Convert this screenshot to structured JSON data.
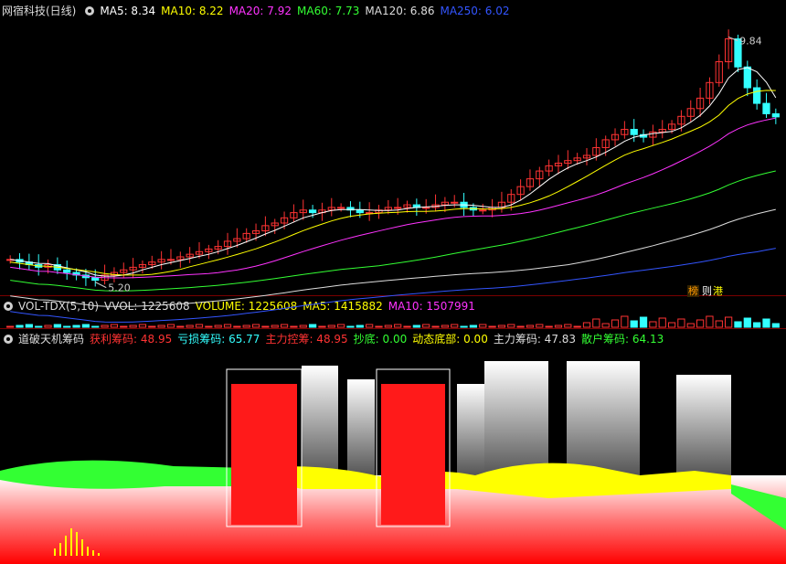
{
  "panel1": {
    "title": "网宿科技(日线)",
    "ma": [
      {
        "label": "MA5: 8.34",
        "color": "#ffffff"
      },
      {
        "label": "MA10: 8.22",
        "color": "#ffff00"
      },
      {
        "label": "MA20: 7.92",
        "color": "#ff33ff"
      },
      {
        "label": "MA60: 7.73",
        "color": "#33ff33"
      },
      {
        "label": "MA120: 6.86",
        "color": "#dddddd"
      },
      {
        "label": "MA250: 6.02",
        "color": "#3355ff"
      }
    ],
    "high_label": "9.84",
    "low_label": "5.20",
    "badges": [
      "榜",
      "则",
      "港"
    ]
  },
  "panel2": {
    "title": "VOL-TDX(5,10)",
    "items": [
      {
        "label": "VVOL: 1225608",
        "color": "#dddddd"
      },
      {
        "label": "VOLUME: 1225608",
        "color": "#ffff00"
      },
      {
        "label": "MA5: 1415882",
        "color": "#ffff00"
      },
      {
        "label": "MA10: 1507991",
        "color": "#ff33ff"
      }
    ]
  },
  "panel3": {
    "title": "道破天机筹码",
    "items": [
      {
        "label": "获利筹码: 48.95",
        "color": "#ff3333"
      },
      {
        "label": "亏损筹码: 65.77",
        "color": "#33ffff"
      },
      {
        "label": "主力控筹: 48.95",
        "color": "#ff3333"
      },
      {
        "label": "抄底: 0.00",
        "color": "#33ff33"
      },
      {
        "label": "动态底部: 0.00",
        "color": "#ffff00"
      },
      {
        "label": "主力筹码: 47.83",
        "color": "#dddddd"
      },
      {
        "label": "散户筹码: 64.13",
        "color": "#33ff33"
      }
    ]
  },
  "chart_data": {
    "type": "candlestick",
    "high_marker": 9.84,
    "low_marker": 5.2,
    "ylim": [
      5.0,
      10.2
    ],
    "close_series": [
      5.6,
      5.55,
      5.5,
      5.45,
      5.5,
      5.4,
      5.35,
      5.3,
      5.25,
      5.2,
      5.3,
      5.35,
      5.4,
      5.45,
      5.5,
      5.55,
      5.6,
      5.6,
      5.65,
      5.7,
      5.75,
      5.8,
      5.85,
      5.95,
      6.0,
      6.1,
      6.15,
      6.25,
      6.3,
      6.4,
      6.5,
      6.55,
      6.5,
      6.55,
      6.6,
      6.6,
      6.55,
      6.5,
      6.5,
      6.55,
      6.6,
      6.6,
      6.65,
      6.6,
      6.6,
      6.65,
      6.7,
      6.7,
      6.6,
      6.55,
      6.55,
      6.6,
      6.7,
      6.85,
      7.0,
      7.15,
      7.3,
      7.4,
      7.45,
      7.5,
      7.55,
      7.6,
      7.75,
      7.9,
      8.0,
      8.1,
      8.0,
      7.95,
      8.05,
      8.1,
      8.2,
      8.35,
      8.5,
      8.7,
      9.0,
      9.4,
      9.84,
      9.3,
      8.9,
      8.6,
      8.4,
      8.34
    ]
  }
}
